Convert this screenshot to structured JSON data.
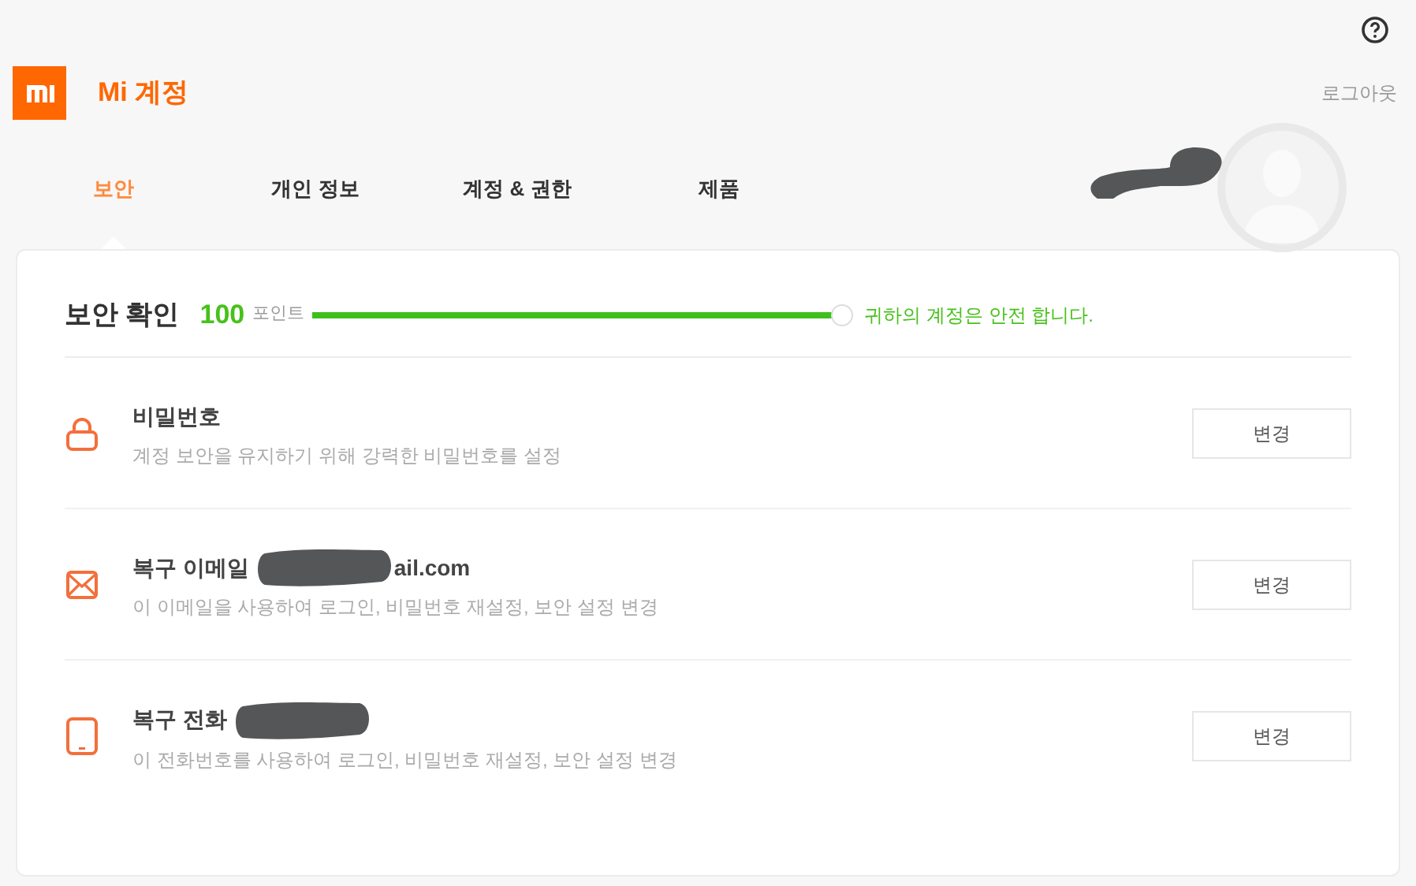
{
  "header": {
    "title": "Mi 계정",
    "logout": "로그아웃"
  },
  "tabs": [
    {
      "label": "보안",
      "selected": true
    },
    {
      "label": "개인 정보",
      "selected": false
    },
    {
      "label": "계정 & 권한",
      "selected": false
    },
    {
      "label": "제품",
      "selected": false
    }
  ],
  "security": {
    "title": "보안 확인",
    "score": "100",
    "score_unit": "포인트",
    "level": 1,
    "status": "귀하의 계정은 안전 합니다."
  },
  "items": [
    {
      "kind": "password",
      "title": "비밀번호",
      "redacted": false,
      "description": "계정 보안을 유지하기 위해 강력한 비밀번호를 설정",
      "button": "변경"
    },
    {
      "kind": "email",
      "title": "복구 이메일",
      "redacted": true,
      "value": "ail.com",
      "description": "이 이메일을 사용하여 로그인, 비밀번호 재설정, 보안 설정 변경",
      "button": "변경"
    },
    {
      "kind": "phone",
      "title": "복구 전화",
      "redacted": true,
      "description": "이 전화번호를 사용하여 로그인, 비밀번호 재설정, 보안 설정 변경",
      "button": "변경"
    }
  ]
}
